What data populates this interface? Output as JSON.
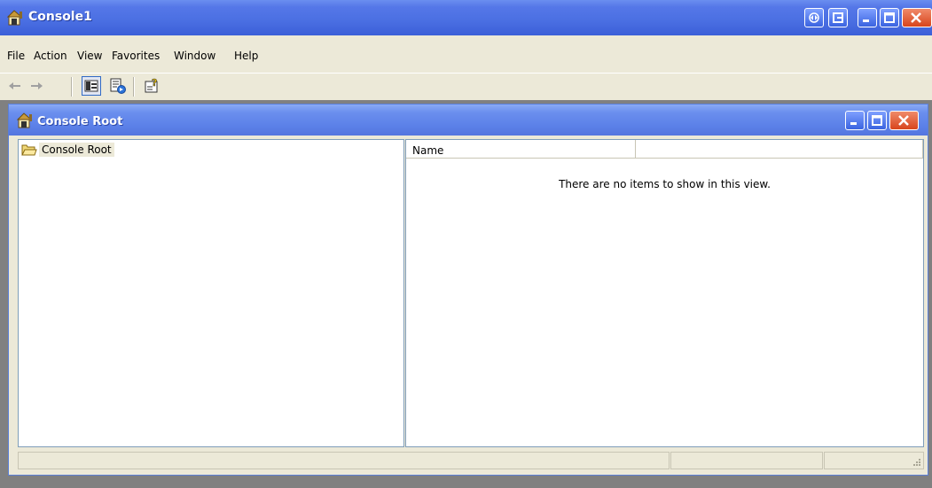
{
  "app": {
    "title": "Console1"
  },
  "menu": {
    "items": [
      "File",
      "Action",
      "View",
      "Favorites",
      "Window",
      "Help"
    ]
  },
  "toolbar": {
    "buttons": [
      "back-arrow-icon",
      "forward-arrow-icon",
      "show-hide-console-tree-icon",
      "export-list-icon",
      "help-icon"
    ]
  },
  "child_window": {
    "title": "Console Root"
  },
  "tree": {
    "root_label": "Console Root"
  },
  "results": {
    "columns": [
      "Name",
      ""
    ],
    "empty_message": "There are no items to show in this view."
  },
  "colors": {
    "titlebar_blue": "#3b5fd8",
    "face": "#ece9d8",
    "close_red": "#d8451c"
  }
}
